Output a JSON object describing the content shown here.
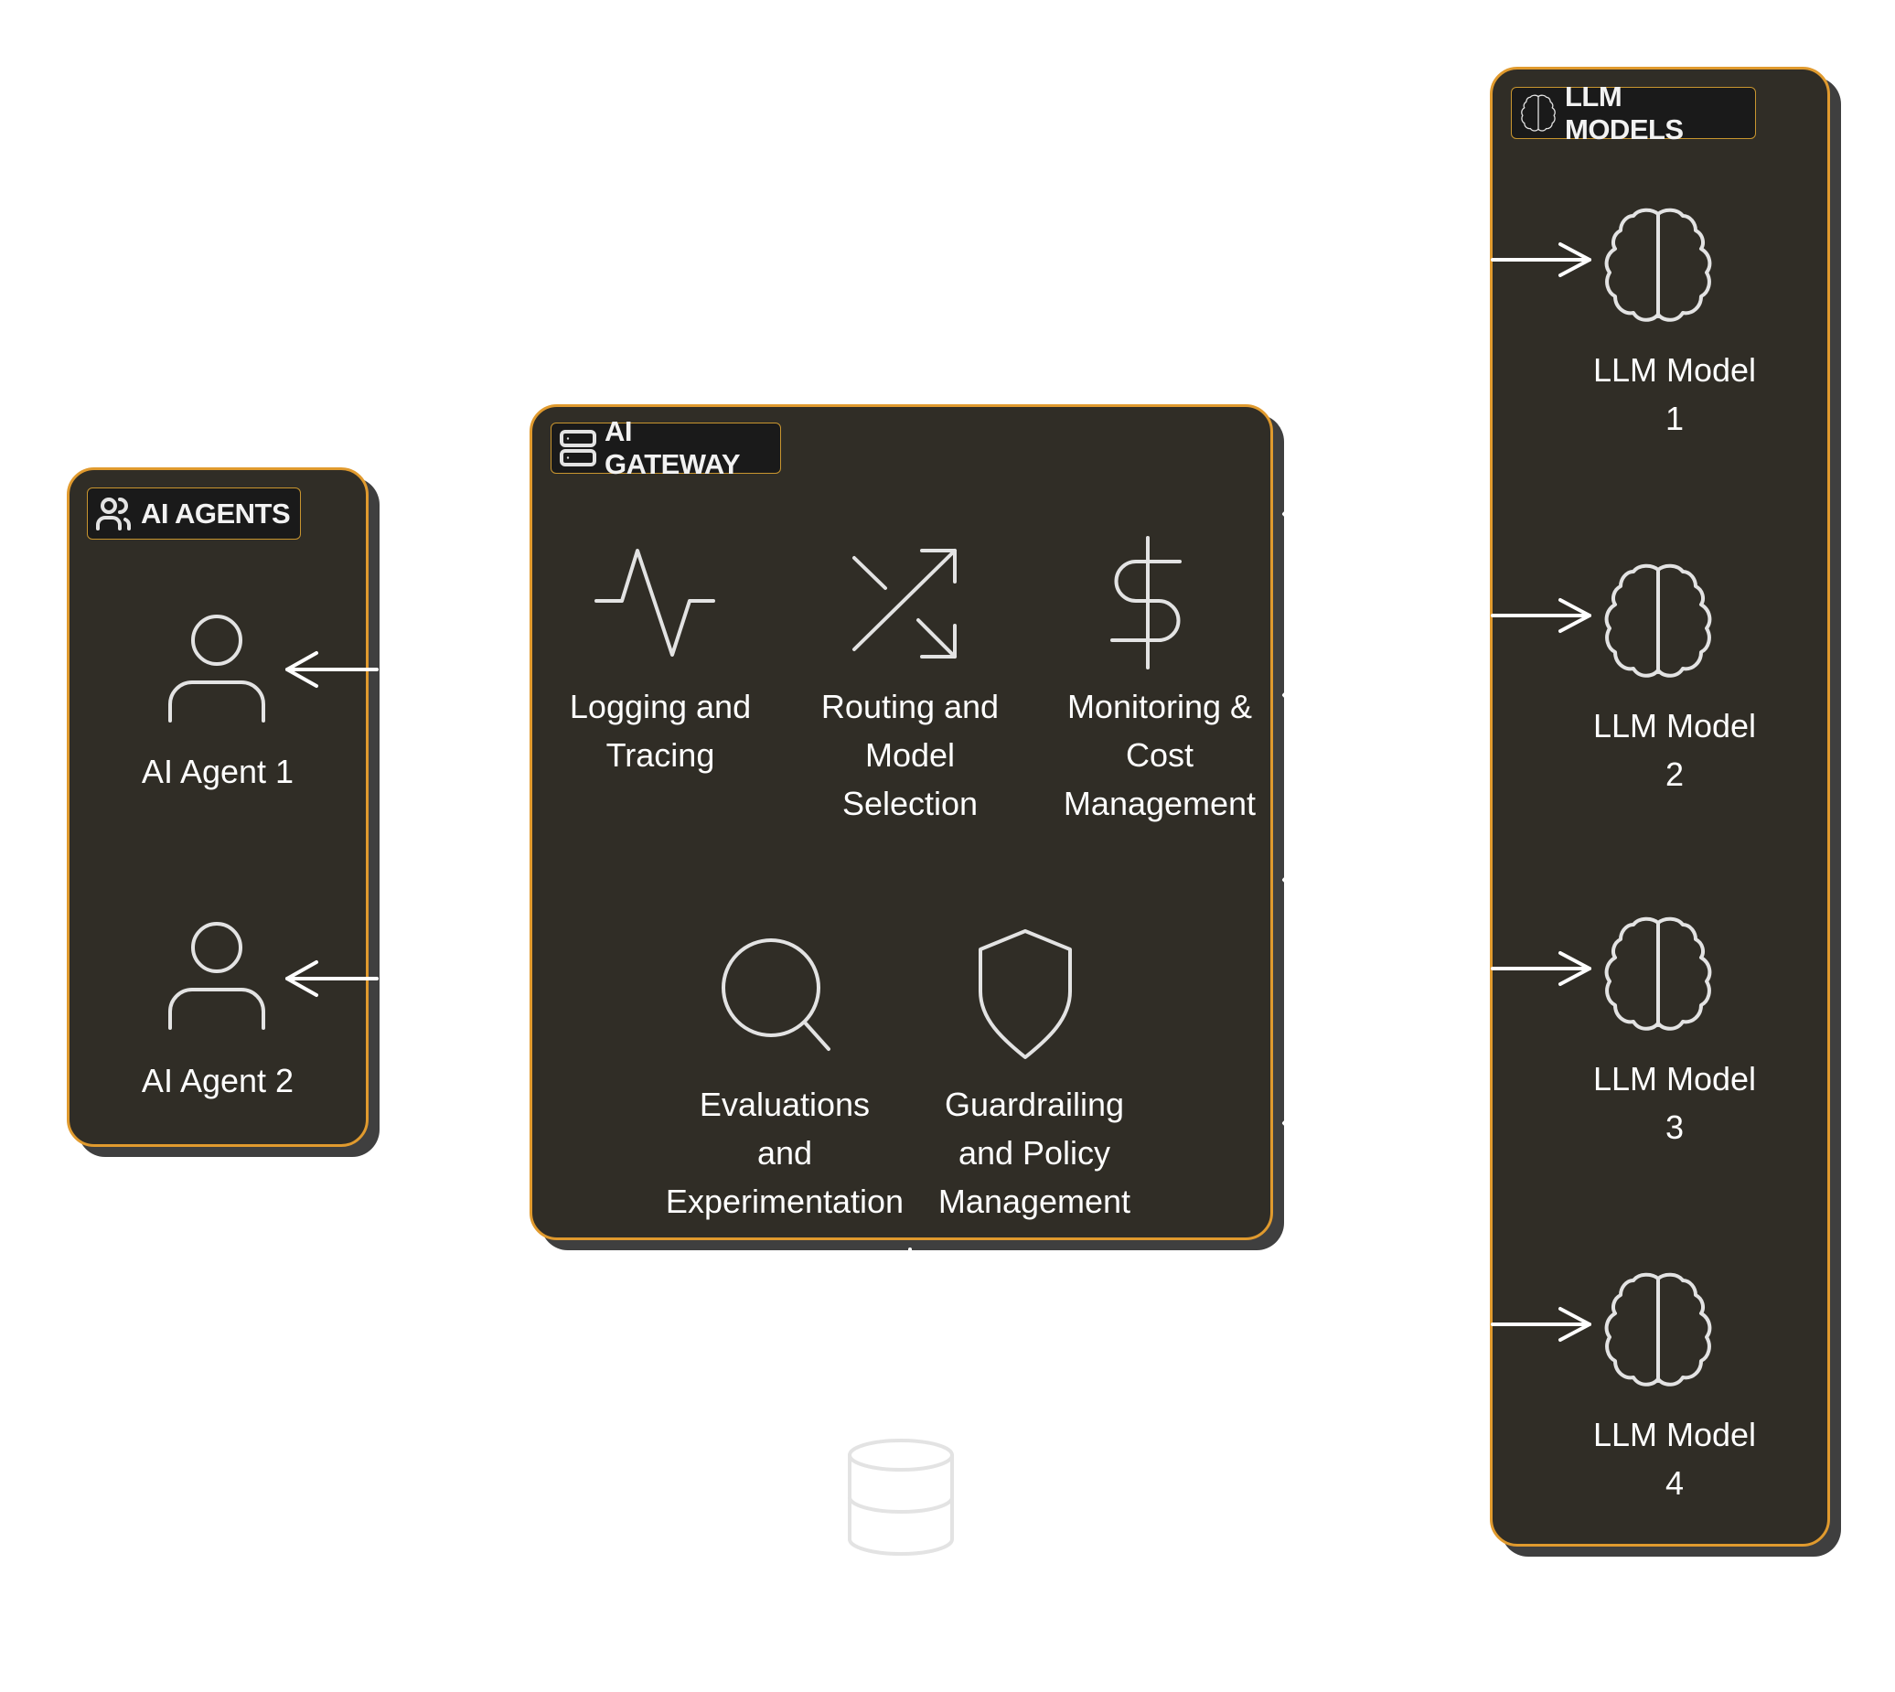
{
  "colors": {
    "background": "#ffffff",
    "group_fill": "#302d26",
    "group_border": "#e09a2e",
    "group_shadow": "#3f3f3f",
    "pill_fill": "#1a1a1a",
    "pill_border": "#c8952f",
    "icon_stroke": "#e3e3e3",
    "text": "#ffffff"
  },
  "agents": {
    "title": "AI AGENTS",
    "title_icon": "users-icon",
    "items": [
      {
        "label": "AI Agent 1",
        "icon": "user-icon"
      },
      {
        "label": "AI Agent 2",
        "icon": "user-icon"
      }
    ]
  },
  "gateway": {
    "title": "AI GATEWAY",
    "title_icon": "server-icon",
    "features": [
      {
        "label": "Logging and\nTracing",
        "icon": "activity-icon"
      },
      {
        "label": "Routing and\nModel\nSelection",
        "icon": "shuffle-icon"
      },
      {
        "label": "Monitoring &\nCost\nManagement",
        "icon": "dollar-icon"
      },
      {
        "label": "Evaluations\nand\nExperimentation",
        "icon": "search-icon"
      },
      {
        "label": "Guardrailing\nand Policy\nManagement",
        "icon": "shield-icon"
      }
    ]
  },
  "models": {
    "title": "LLM MODELS",
    "title_icon": "brain-icon",
    "items": [
      {
        "label": "LLM Model\n1",
        "icon": "brain-icon"
      },
      {
        "label": "LLM Model\n2",
        "icon": "brain-icon"
      },
      {
        "label": "LLM Model\n3",
        "icon": "brain-icon"
      },
      {
        "label": "LLM Model\n4",
        "icon": "brain-icon"
      }
    ]
  },
  "storage": {
    "icon": "database-icon"
  }
}
